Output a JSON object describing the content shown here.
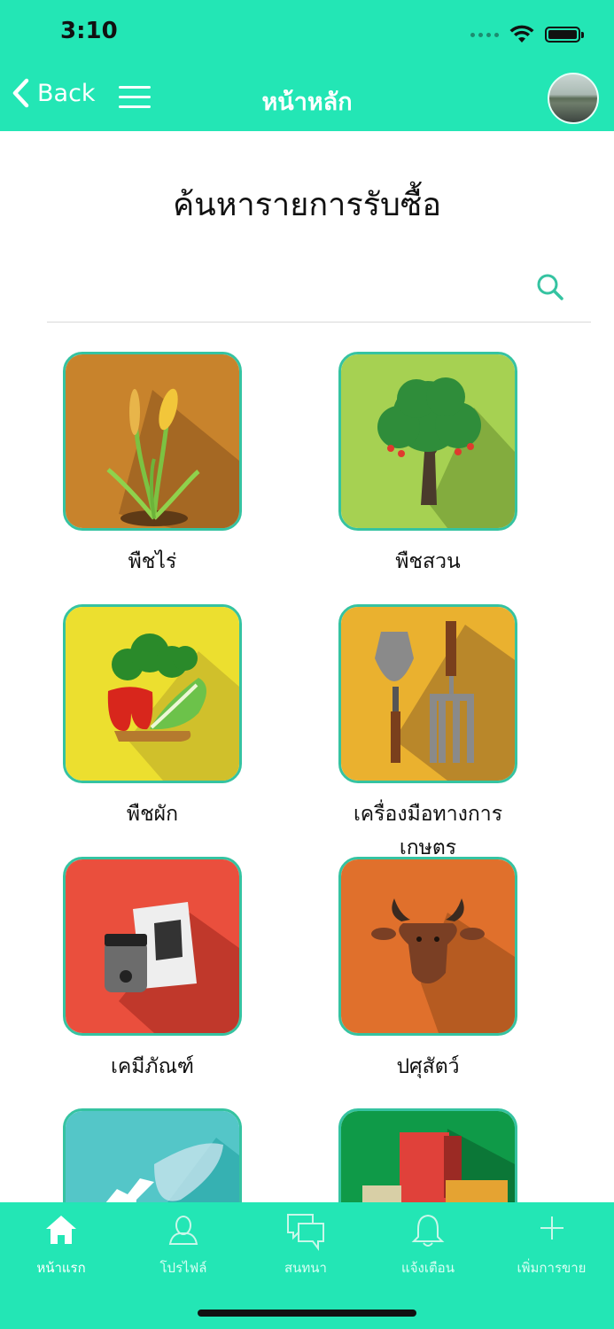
{
  "status": {
    "time": "3:10"
  },
  "nav": {
    "back_label": "Back",
    "title": "หน้าหลัก"
  },
  "page": {
    "title": "ค้นหารายการรับซื้อ"
  },
  "search": {
    "placeholder": "",
    "value": ""
  },
  "categories": [
    {
      "label": "พืชไร่",
      "icon": "rice-plant-icon",
      "color": "#c8832c"
    },
    {
      "label": "พืชสวน",
      "icon": "fruit-tree-icon",
      "color": "#a6d152"
    },
    {
      "label": "พืชผัก",
      "icon": "vegetables-icon",
      "color": "#ecdf2f"
    },
    {
      "label": "เครื่องมือทางการเกษตร",
      "icon": "garden-tools-icon",
      "color": "#eab12f"
    },
    {
      "label": "เคมีภัณฑ์",
      "icon": "chemicals-icon",
      "color": "#ea4f3d"
    },
    {
      "label": "ปศุสัตว์",
      "icon": "cow-icon",
      "color": "#e0702c"
    },
    {
      "label": "",
      "icon": "fishing-icon",
      "color": "#54c6c8"
    },
    {
      "label": "",
      "icon": "boxes-icon",
      "color": "#0f9a48"
    }
  ],
  "tabbar": {
    "items": [
      {
        "label": "หน้าแรก",
        "icon": "home-icon",
        "active": true
      },
      {
        "label": "โปรไฟล์",
        "icon": "profile-icon",
        "active": false
      },
      {
        "label": "สนทนา",
        "icon": "chat-icon",
        "active": false
      },
      {
        "label": "แจ้งเตือน",
        "icon": "bell-icon",
        "active": false
      },
      {
        "label": "เพิ่มการขาย",
        "icon": "plus-icon",
        "active": false
      }
    ]
  },
  "colors": {
    "primary": "#23e6b5",
    "accent": "#35c3a1"
  }
}
